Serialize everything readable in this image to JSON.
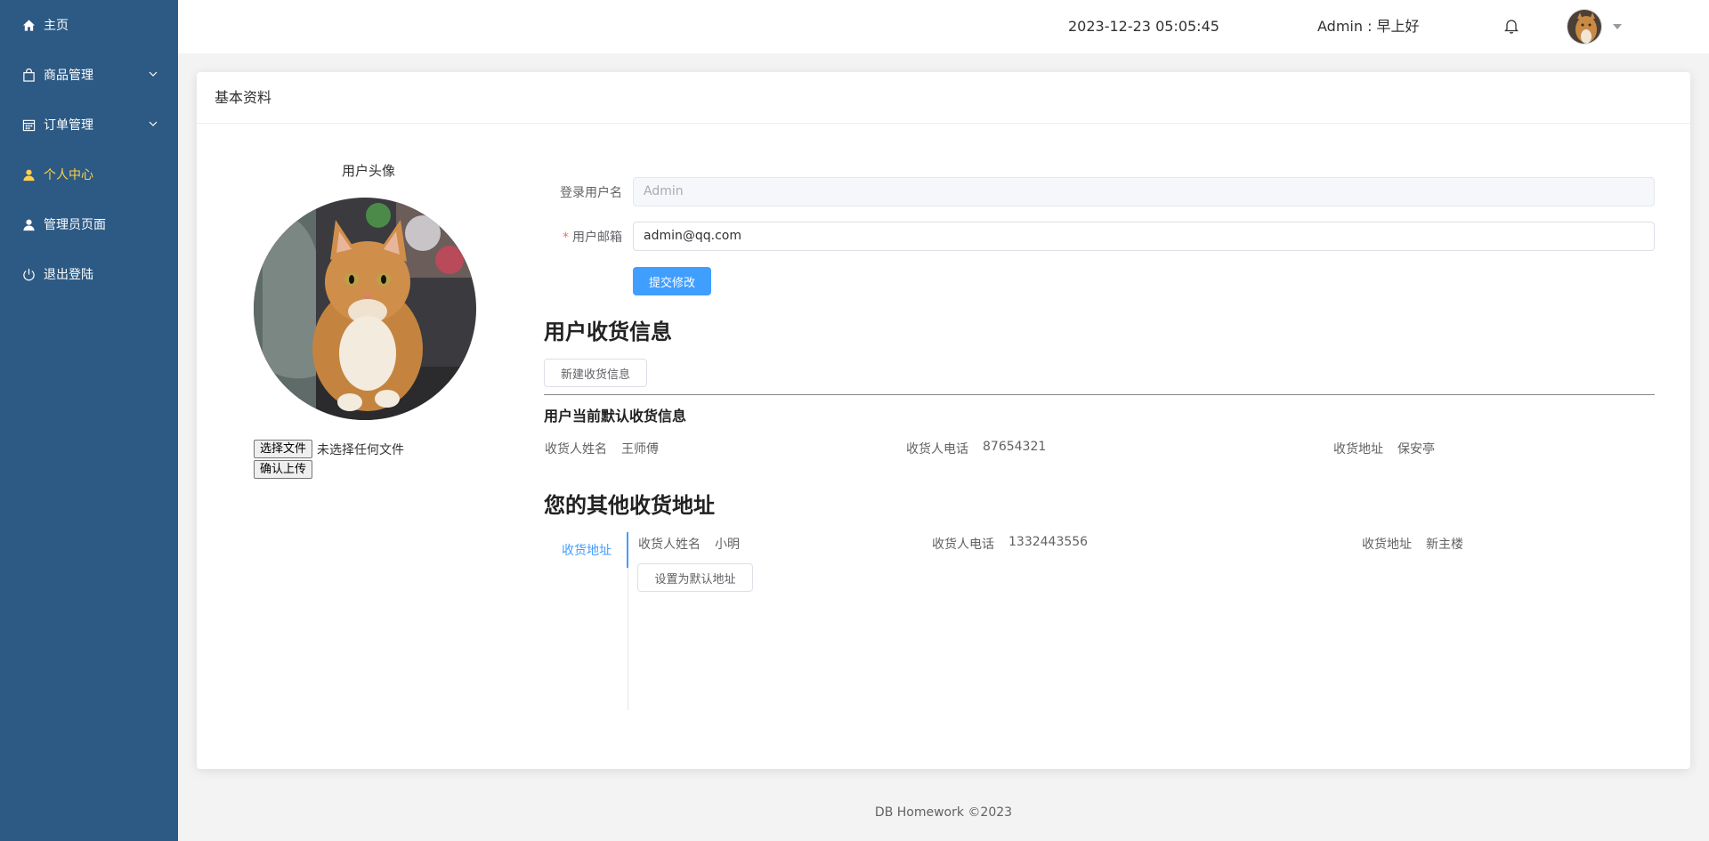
{
  "sidebar": {
    "items": [
      {
        "label": "主页",
        "icon": "home-icon"
      },
      {
        "label": "商品管理",
        "icon": "shopping-bag-icon"
      },
      {
        "label": "订单管理",
        "icon": "calendar-icon"
      },
      {
        "label": "个人中心",
        "icon": "user-icon"
      },
      {
        "label": "管理员页面",
        "icon": "user-icon"
      },
      {
        "label": "退出登陆",
        "icon": "power-icon"
      }
    ],
    "bg_color": "#2d5a84",
    "active_color": "#ffd04b"
  },
  "header": {
    "datetime": "2023-12-23 05:05:45",
    "greeting": "Admin : 早上好"
  },
  "card": {
    "title": "基本资料"
  },
  "avatar": {
    "label": "用户头像",
    "choose_file": "选择文件",
    "no_file": "未选择任何文件",
    "confirm_upload": "确认上传"
  },
  "form": {
    "username_label": "登录用户名",
    "username_value": "Admin",
    "email_label": "用户邮箱",
    "email_value": "admin@qq.com",
    "submit": "提交修改"
  },
  "shipping": {
    "title": "用户收货信息",
    "new_button": "新建收货信息",
    "default_title": "用户当前默认收货信息",
    "default": {
      "name_label": "收货人姓名",
      "name": "王师傅",
      "phone_label": "收货人电话",
      "phone": "87654321",
      "address_label": "收货地址",
      "address": "保安亭"
    },
    "other_title": "您的其他收货地址",
    "tab_label": "收货地址",
    "other": {
      "name_label": "收货人姓名",
      "name": "小明",
      "phone_label": "收货人电话",
      "phone": "1332443556",
      "address_label": "收货地址",
      "address": "新主楼",
      "set_default": "设置为默认地址"
    }
  },
  "footer": "DB Homework ©2023",
  "colors": {
    "primary": "#409eff"
  }
}
